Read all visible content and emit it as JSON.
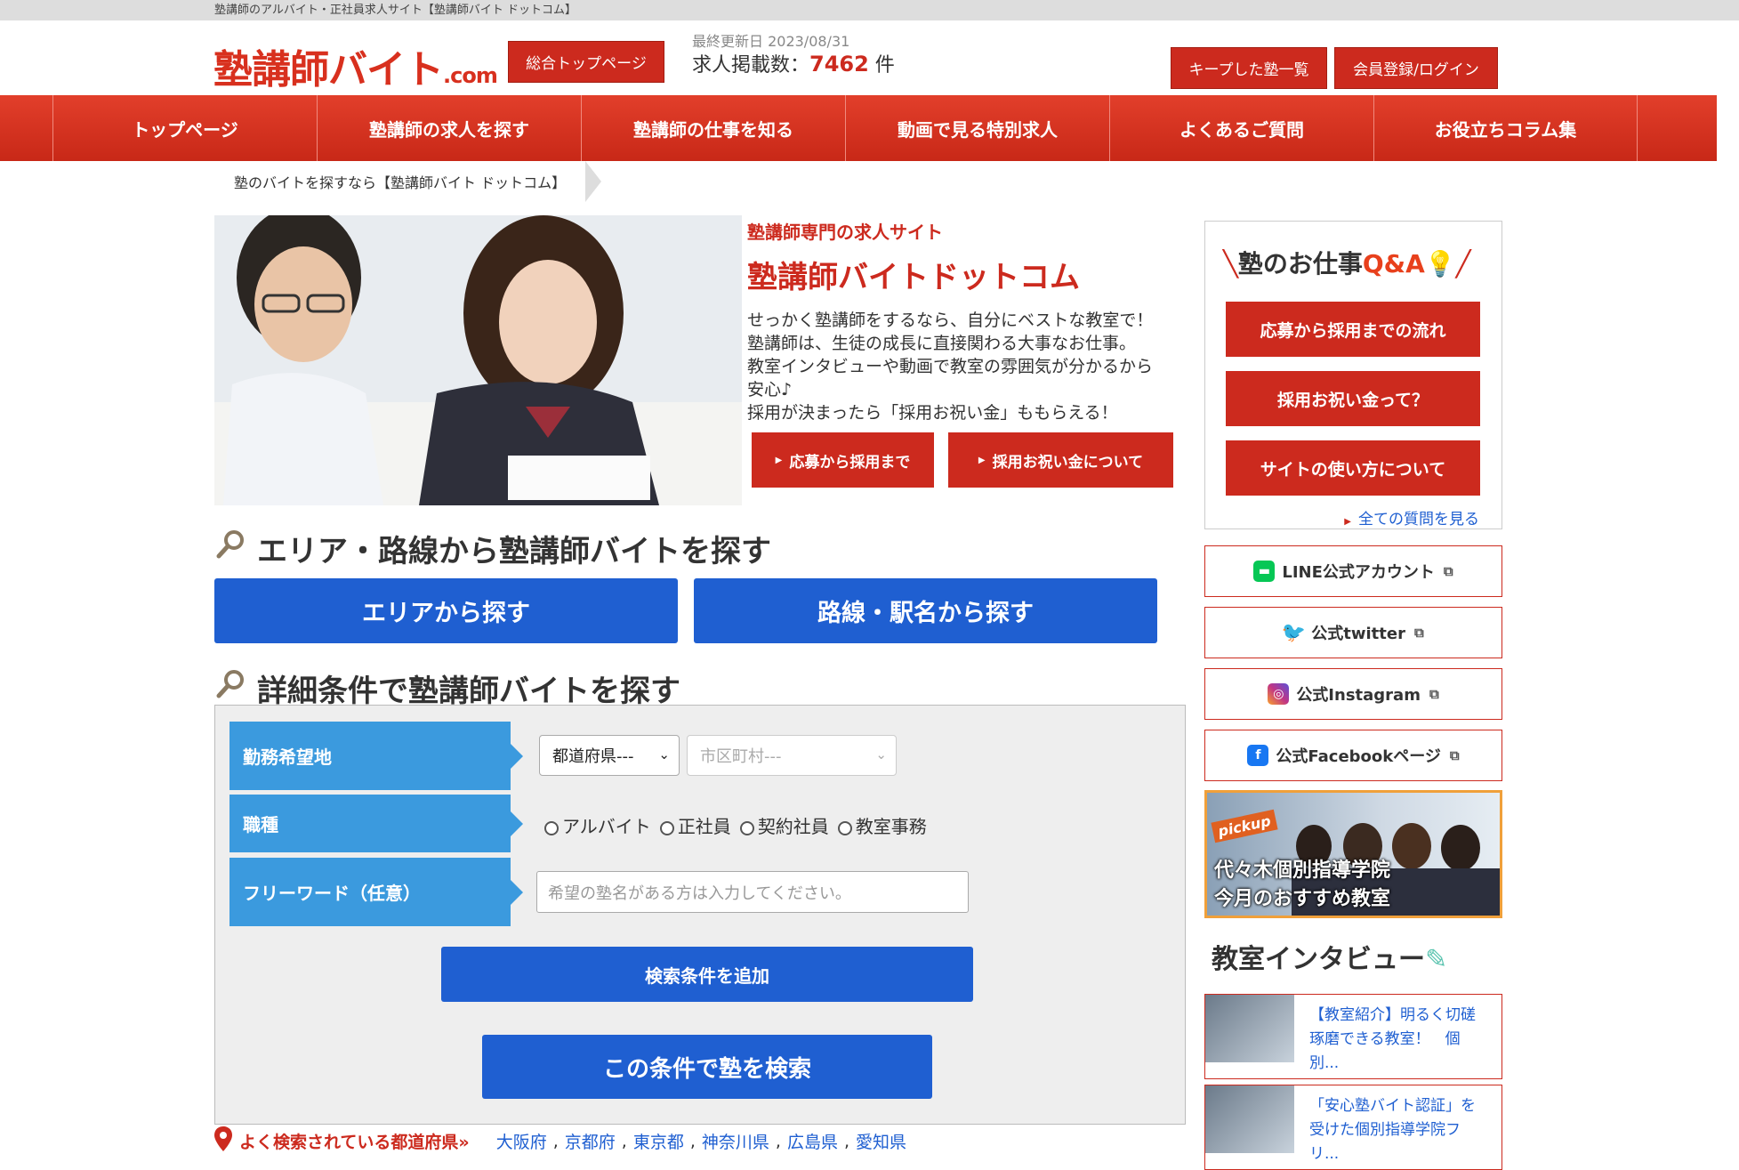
{
  "topstrip": {
    "text": "塾講師のアルバイト・正社員求人サイト【塾講師バイト ドットコム】"
  },
  "header": {
    "logo_text": "塾講師バイト",
    "logo_suffix": ".com",
    "top_page_button": "総合トップページ",
    "updated": "最終更新日 2023/08/31",
    "count_label": "求人掲載数：",
    "count_value": "7462",
    "count_unit": " 件",
    "kept_button": "キープした塾一覧",
    "login_button": "会員登録/ログイン"
  },
  "nav": {
    "items": [
      "トップページ",
      "塾講師の求人を探す",
      "塾講師の仕事を知る",
      "動画で見る特別求人",
      "よくあるご質問",
      "お役立ちコラム集"
    ]
  },
  "breadcrumb": {
    "text": "塾のバイトを探すなら【塾講師バイト ドットコム】"
  },
  "hero": {
    "subtitle": "塾講師専門の求人サイト",
    "title": "塾講師バイトドットコム",
    "desc": [
      "せっかく塾講師をするなら、自分にベストな教室で！",
      "塾講師は、生徒の成長に直接関わる大事なお仕事。",
      "教室インタビューや動画で教室の雰囲気が分かるから",
      "安心♪",
      "採用が決まったら「採用お祝い金」ももらえる！"
    ],
    "btn1": "応募から採用まで",
    "btn2": "採用お祝い金について"
  },
  "area_search": {
    "heading": "エリア・路線から塾講師バイトを探す",
    "area_button": "エリアから探す",
    "line_button": "路線・駅名から探す"
  },
  "detail_search": {
    "heading": "詳細条件で塾講師バイトを探す",
    "location_label": "勤務希望地",
    "pref_select": "都道府県---",
    "city_select": "市区町村---",
    "job_label": "職種",
    "job_options": [
      "アルバイト",
      "正社員",
      "契約社員",
      "教室事務"
    ],
    "freeword_label": "フリーワード（任意）",
    "freeword_placeholder": "希望の塾名がある方は入力してください。",
    "add_condition_button": "検索条件を追加",
    "search_button": "この条件で塾を検索"
  },
  "popular": {
    "label": "よく検索されている都道府県»",
    "prefs": [
      "大阪府",
      "京都府",
      "東京都",
      "神奈川県",
      "広島県",
      "愛知県"
    ]
  },
  "sidebar": {
    "qa_title_main": "塾のお仕事",
    "qa_title_accent": "Q&A",
    "qa_buttons": [
      "応募から採用までの流れ",
      "採用お祝い金って？",
      "サイトの使い方について"
    ],
    "qa_more": "全ての質問を見る",
    "sns": [
      {
        "label": "LINE公式アカウント",
        "icon": "line-icon",
        "color": "#06c755"
      },
      {
        "label": "公式twitter",
        "icon": "twitter-icon",
        "color": "#1d9bf0"
      },
      {
        "label": "公式Instagram",
        "icon": "instagram-icon",
        "color": "#c13584"
      },
      {
        "label": "公式Facebookページ",
        "icon": "facebook-icon",
        "color": "#1877f2"
      }
    ],
    "pickup_tag": "pickup",
    "pickup_line1": "代々木個別指導学院",
    "pickup_line2": "今月のおすすめ教室",
    "interview_heading": "教室インタビュー",
    "interviews": [
      "【教室紹介】明るく切磋琢磨できる教室！　個別...",
      "「安心塾バイト認証」を受けた個別指導学院フリ..."
    ]
  },
  "colors": {
    "brand_red": "#cc2a1e",
    "blue": "#1f5fd1",
    "label_blue": "#3b9ade"
  }
}
